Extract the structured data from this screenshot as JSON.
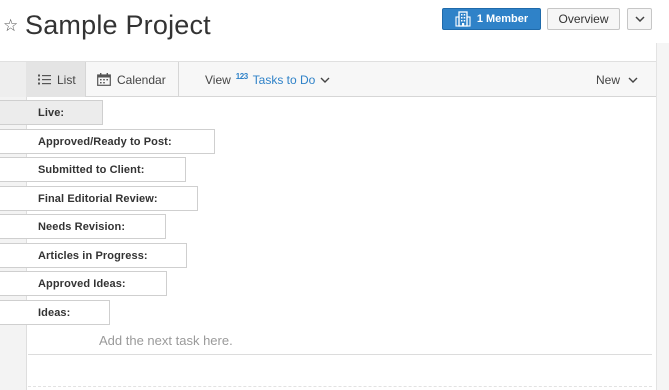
{
  "header": {
    "title": "Sample Project",
    "members_label": "1 Member",
    "overview_label": "Overview"
  },
  "toolbar": {
    "list_label": "List",
    "calendar_label": "Calendar",
    "view_label": "View",
    "view_superscript": "123",
    "view_value": "Tasks to Do",
    "new_label": "New"
  },
  "groups": [
    {
      "label": "Live:"
    },
    {
      "label": "Approved/Ready to Post:"
    },
    {
      "label": "Submitted to Client:"
    },
    {
      "label": "Final Editorial Review:"
    },
    {
      "label": "Needs Revision:"
    },
    {
      "label": "Articles in Progress:"
    },
    {
      "label": "Approved Ideas:"
    },
    {
      "label": "Ideas:"
    }
  ],
  "add_task_placeholder": "Add the next task here.",
  "colors": {
    "accent": "#2f82c8",
    "text": "#333333",
    "muted": "#9a9a9a"
  },
  "icons": [
    "star-icon",
    "building-icon",
    "chevron-down-icon",
    "list-icon",
    "calendar-icon",
    "sort-numeric-icon"
  ]
}
